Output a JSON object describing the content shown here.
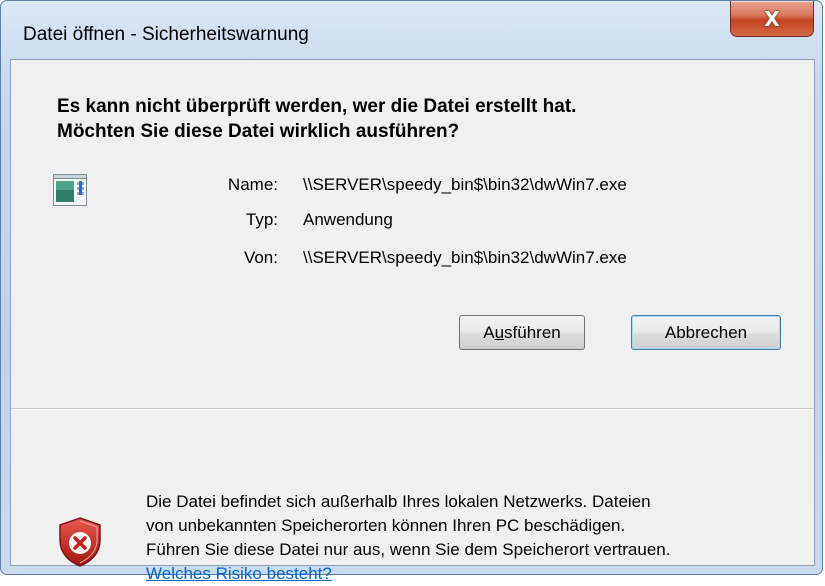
{
  "window": {
    "title": "Datei öffnen - Sicherheitswarnung",
    "close_label": "X"
  },
  "heading": {
    "line1": "Es kann nicht überprüft werden, wer die Datei erstellt hat.",
    "line2": "Möchten Sie diese Datei wirklich ausführen?"
  },
  "file_info": {
    "name_label": "Name:",
    "name_value": "\\\\SERVER\\speedy_bin$\\bin32\\dwWin7.exe",
    "type_label": "Typ:",
    "type_value": "Anwendung",
    "from_label": "Von:",
    "from_value": "\\\\SERVER\\speedy_bin$\\bin32\\dwWin7.exe"
  },
  "buttons": {
    "run_prefix": "A",
    "run_mnemonic": "u",
    "run_suffix": "sführen",
    "cancel_label": "Abbrechen"
  },
  "warning": {
    "line1": "Die Datei befindet sich außerhalb Ihres lokalen Netzwerks. Dateien",
    "line2": "von unbekannten Speicherorten können Ihren PC beschädigen.",
    "line3": "Führen Sie diese Datei nur aus, wenn Sie dem Speicherort vertrauen.",
    "link": "Welches Risiko besteht?"
  },
  "icons": {
    "app": "application-icon",
    "shield": "security-shield-error-icon"
  },
  "colors": {
    "link": "#0066cc",
    "shield_red": "#c8201c"
  }
}
